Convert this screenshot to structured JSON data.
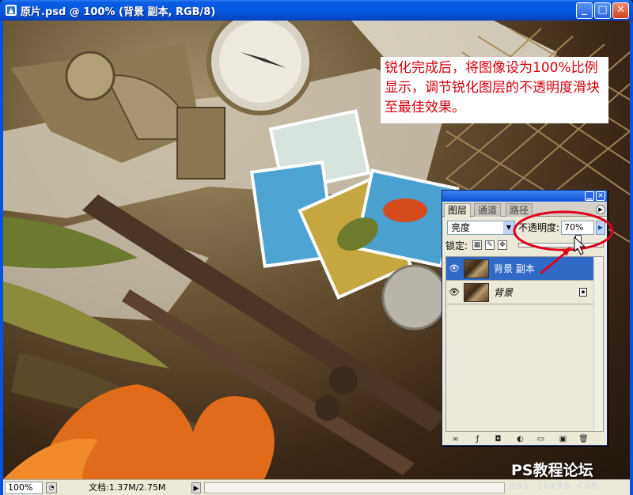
{
  "window": {
    "title": "原片.psd @ 100% (背景 副本, RGB/8)",
    "min_label": "_",
    "max_label": "□",
    "close_label": "✕"
  },
  "annotation": {
    "text": "锐化完成后，将图像设为100%比例显示，调节锐化图层的不透明度滑块至最佳效果。"
  },
  "layers_panel": {
    "tabs": [
      "图层",
      "通道",
      "路径"
    ],
    "active_tab": 0,
    "blend_mode": "亮度",
    "opacity_label": "不透明度:",
    "opacity_value": "70%",
    "opacity_fraction": 0.7,
    "lock_label": "锁定:",
    "layers": [
      {
        "name": "背景 副本",
        "selected": true,
        "locked": false
      },
      {
        "name": "背景",
        "selected": false,
        "locked": true
      }
    ],
    "accent_color": "#316ac5"
  },
  "status": {
    "zoom": "100%",
    "doc": "文档:1.37M/2.75M"
  },
  "watermark": {
    "title": "PS教程论坛",
    "url": "BBS.16XX8.COM"
  },
  "colors": {
    "annotation_text": "#d4000a",
    "annotation_circle": "#e0001b",
    "titlebar": "#0658e0"
  }
}
